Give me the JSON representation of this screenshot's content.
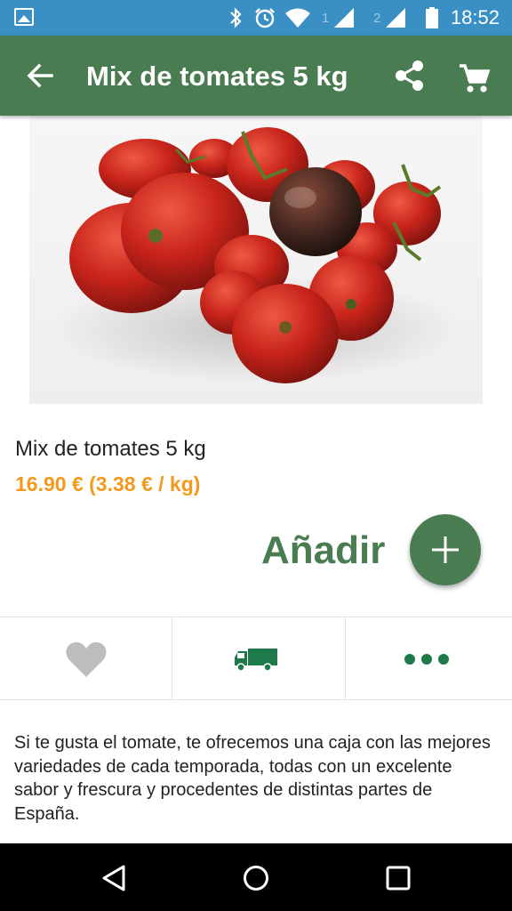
{
  "status_bar": {
    "time": "18:52",
    "sim1": "1",
    "sim2": "2",
    "icons": [
      "gallery-icon",
      "bluetooth-icon",
      "alarm-icon",
      "wifi-icon",
      "signal-icon",
      "signal-icon",
      "battery-icon"
    ]
  },
  "app_bar": {
    "title": "Mix de tomates 5 kg",
    "icons": [
      "back-arrow-icon",
      "share-icon",
      "cart-icon"
    ]
  },
  "product": {
    "name": "Mix de tomates 5 kg",
    "price": "16.90 € (3.38 € / kg)",
    "add_label": "Añadir",
    "description": "Si te gusta el tomate, te ofrecemos una caja con las mejores variedades de cada temporada,  todas con un excelente sabor y frescura y procedentes de distintas partes de España."
  },
  "actions": [
    "heart-icon",
    "truck-icon",
    "more-dots-icon"
  ],
  "colors": {
    "status_bar": "#3a8fc4",
    "primary": "#4a7c52",
    "price": "#f39a1d",
    "heart": "#bdbdbd",
    "action_icon": "#1e7a4a"
  },
  "nav_bar": {
    "icons": [
      "back-triangle-icon",
      "home-circle-icon",
      "recents-square-icon"
    ]
  }
}
